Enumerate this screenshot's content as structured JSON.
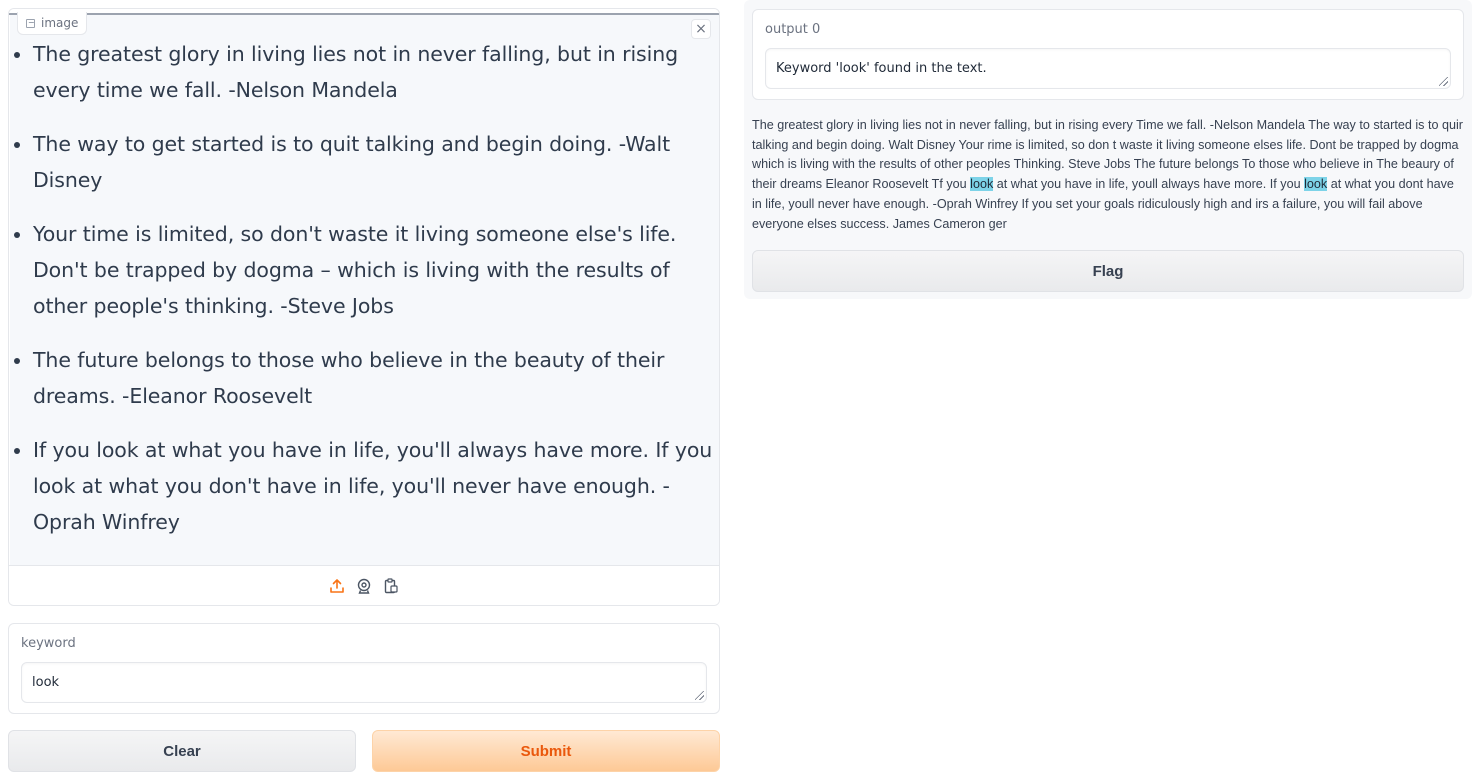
{
  "input": {
    "image_label": "image",
    "close_icon": "close-icon",
    "quotes": [
      "The greatest glory in living lies not in never falling, but in rising every time we fall. -Nelson Mandela",
      "The way to get started is to quit talking and begin doing. -Walt Disney",
      "Your time is limited, so don't waste it living someone else's life. Don't be trapped by dogma – which is living with the results of other people's thinking. -Steve Jobs",
      "The future belongs to those who believe in the beauty of their dreams. -Eleanor Roosevelt",
      "If you look at what you have in life, you'll always have more. If you look at what you don't have in life, you'll never have enough. -Oprah Winfrey",
      "If you set your goals ridiculously high and it's a failure, you will fail above everyone else's success. -James Cameron"
    ],
    "source_icons": [
      "upload-icon",
      "webcam-icon",
      "clipboard-icon"
    ],
    "accent_color": "#f97316"
  },
  "keyword": {
    "label": "keyword",
    "value": "look"
  },
  "buttons": {
    "clear": "Clear",
    "submit": "Submit",
    "flag": "Flag"
  },
  "output": {
    "label": "output 0",
    "value": "Keyword 'look' found in the text.",
    "highlight_color": "#7dd3e8",
    "highlighted_text": {
      "before": "The greatest glory in living lies not in never falling, but in rising every Time we fall. -Nelson Mandela The way to started is to quir talking and begin doing. Walt Disney Your rime is limited, so don t waste it living someone elses life. Dont be trapped by dogma which is living with the results of other peoples Thinking. Steve Jobs The future belongs To those who believe in The beaury of their dreams Eleanor Roosevelt Tf you ",
      "match1": "look",
      "middle": " at what you have in life, youll always have more. If you ",
      "match2": "look",
      "after": " at what you dont have in life, youll never have enough. -Oprah Winfrey If you set your goals ridiculously high and irs a failure, you will fail above everyone elses success. James Cameron ger"
    }
  }
}
